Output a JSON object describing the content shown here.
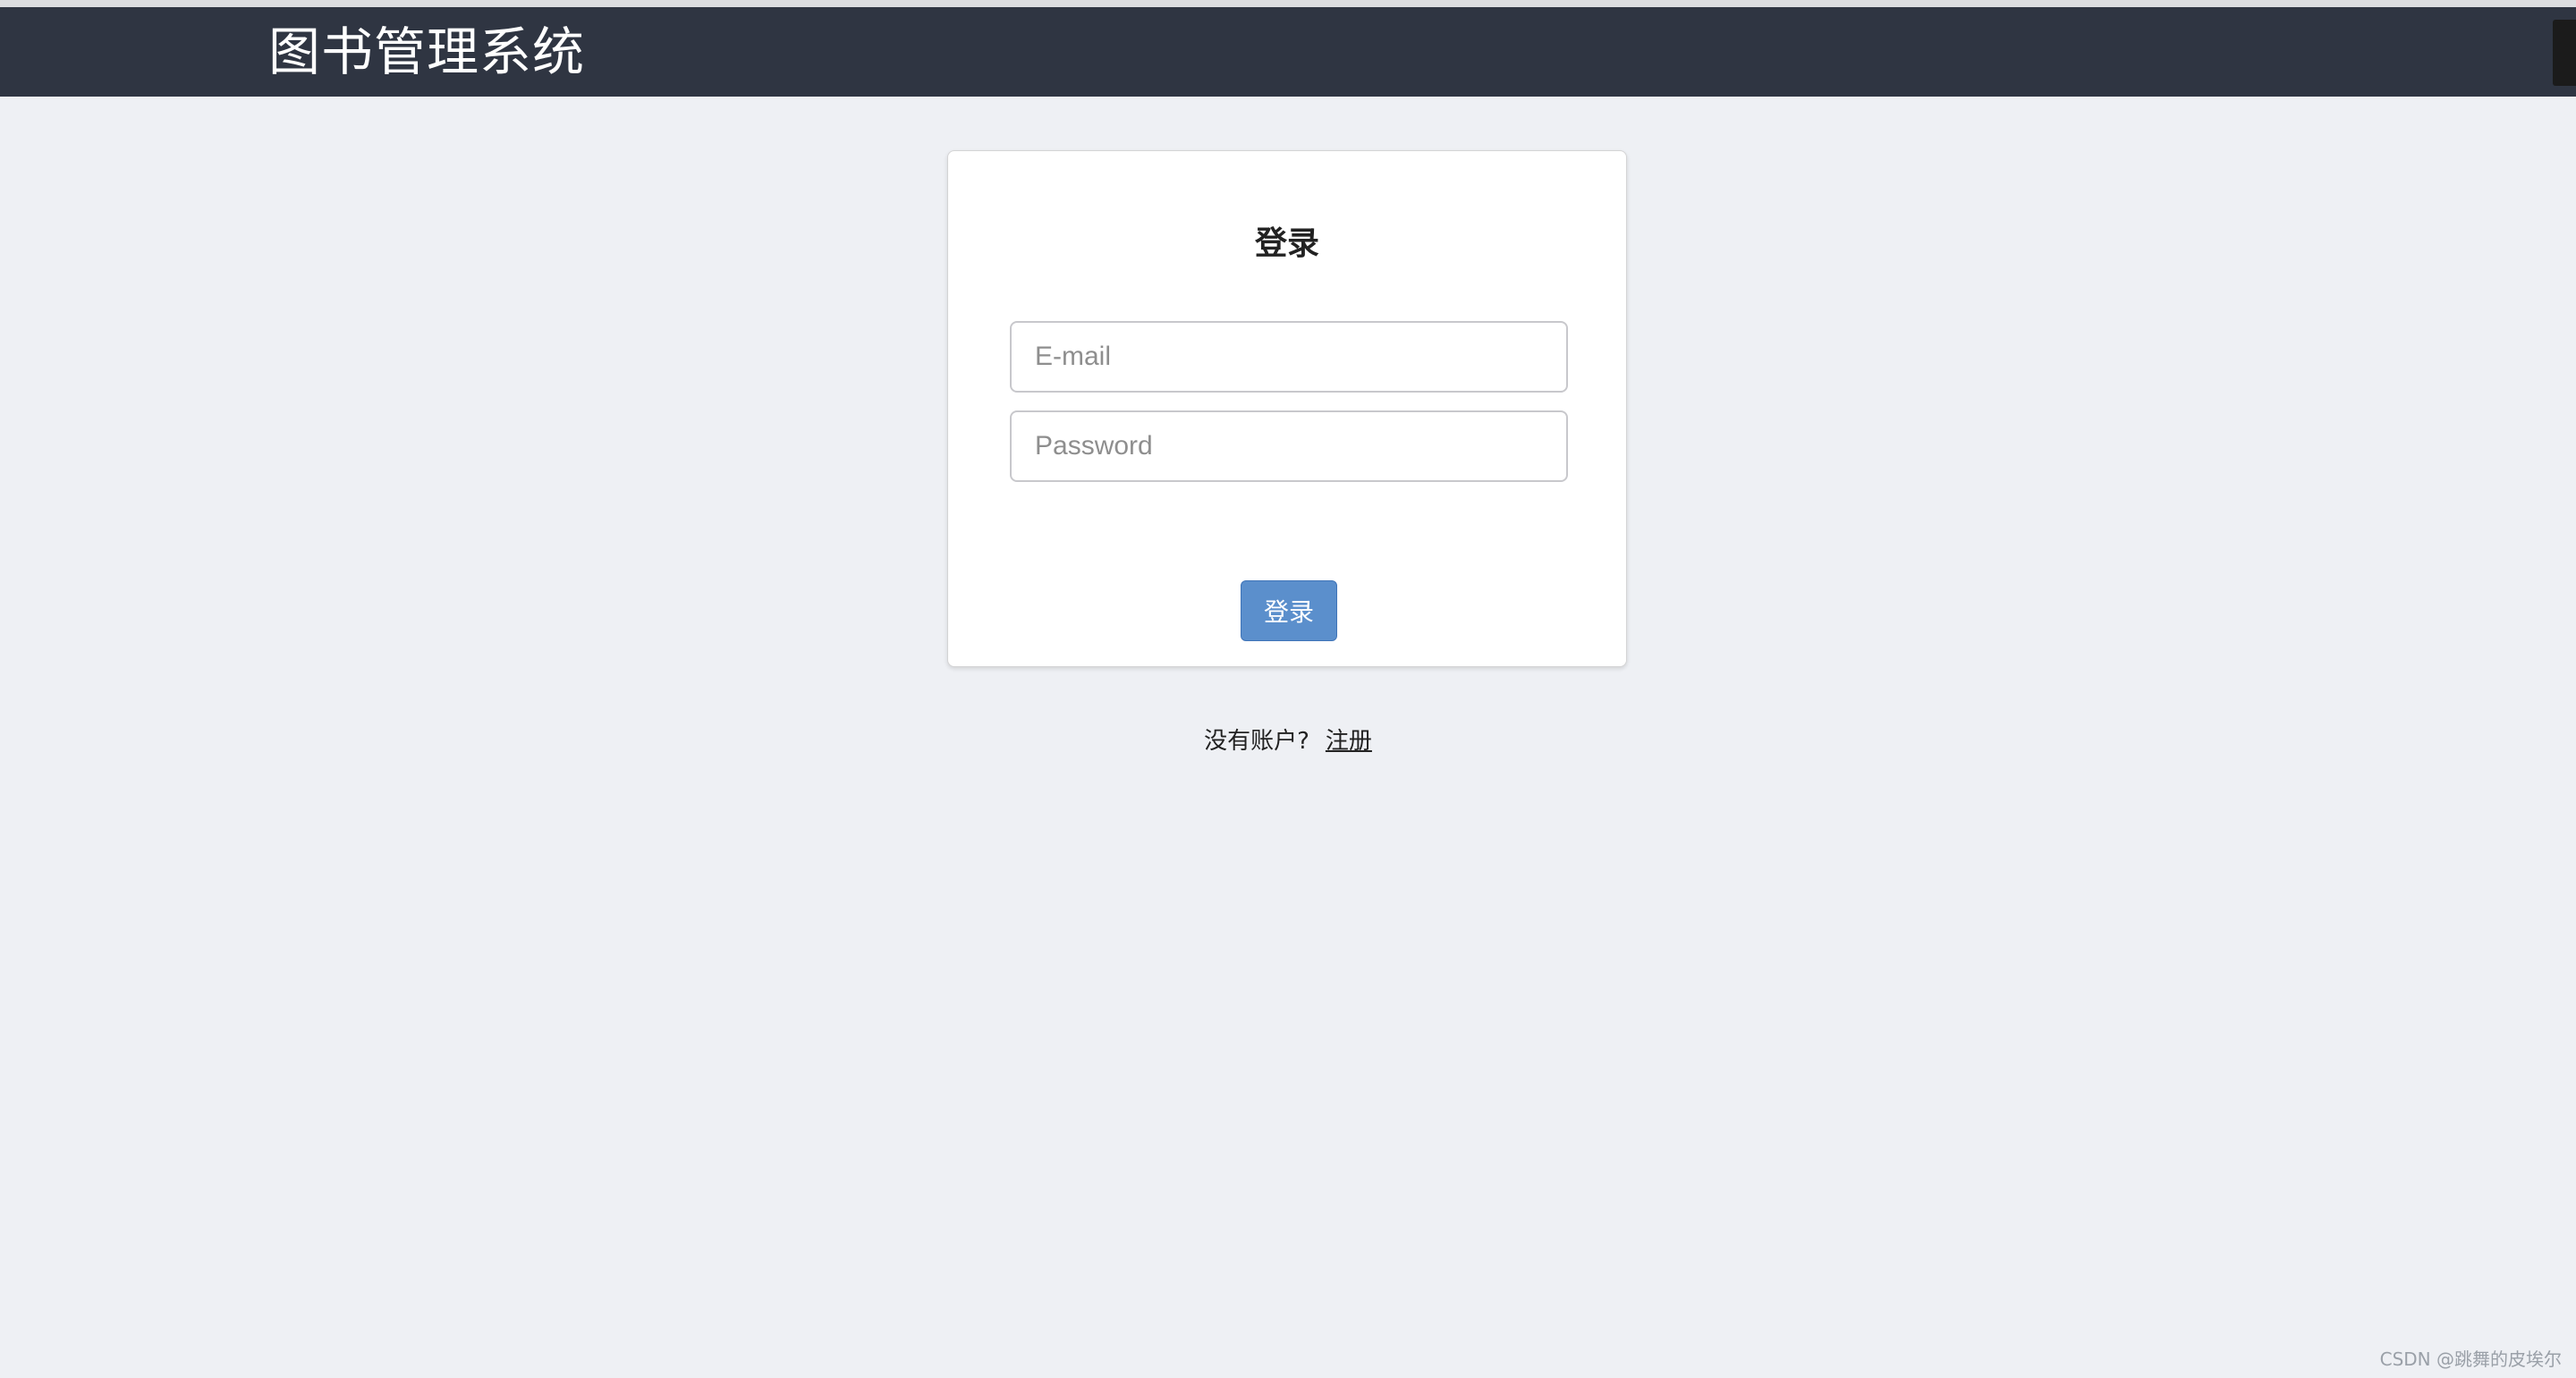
{
  "header": {
    "title": "图书管理系统"
  },
  "login": {
    "title": "登录",
    "email_placeholder": "E-mail",
    "password_placeholder": "Password",
    "submit_label": "登录"
  },
  "signup": {
    "prompt": "没有账户?",
    "link_label": "注册"
  },
  "watermark": "CSDN @跳舞的皮埃尔",
  "colors": {
    "header_bg": "#2f3542",
    "page_bg": "#eef0f4",
    "button_bg": "#5b8fcc"
  }
}
